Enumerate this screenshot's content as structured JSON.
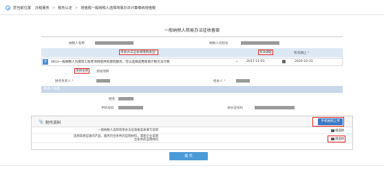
{
  "breadcrumb": {
    "prefix": "您当前位置",
    "items": [
      "办税服务",
      "税务认定",
      "增值税一般纳税人选择简易办法计算缴纳增值税"
    ],
    "separator": ">"
  },
  "form": {
    "title": "一般纳税人简易办法征收备案",
    "taxpayer_name_label": "纳税人名称",
    "taxpayer_id_label": "纳税人识别号",
    "simple_method_type_label": "简易办法征收增值税类型",
    "effective_start_label": "有效期起",
    "effective_end_label": "有效期止",
    "type_value": "0813一般纳税人为建筑工程老项目提供的建筑服务，可以选择适用简易计税方法计税",
    "start_date": "2017-11-01",
    "end_date": "2020-10-31",
    "project_name_label": "项目名称",
    "project_name_value": "测试项目",
    "finance_manager_label": "财务负责人",
    "handler_label": "经办人",
    "section_contact": "联系人信息",
    "name_label": "姓名",
    "mobile_label": "手机号码",
    "id_number_label": "身份证号码",
    "required_mark": "*",
    "add_symbol": "+"
  },
  "attachments": {
    "title": "附件资料",
    "upload_button": "手机拍照上传",
    "choose_label": "请选择",
    "items": [
      "一般纳税人选择简易办法征收备案表填写说明",
      "选择简易征收的产品、服务符合条件的证明材料，或者企业说明\n合条件的证明材料"
    ]
  },
  "submit_label": "提 交",
  "colors": {
    "highlight": "#e02020",
    "accent_blue": "#3b78c4",
    "row_blue": "#dce9f5",
    "redacted": "#9a9a9a"
  }
}
